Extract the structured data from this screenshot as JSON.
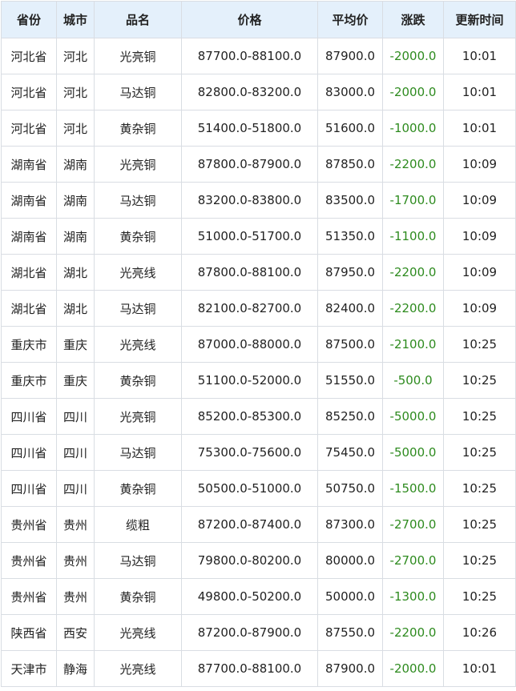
{
  "table": {
    "headers": [
      "省份",
      "城市",
      "品名",
      "价格",
      "平均价",
      "涨跌",
      "更新时间"
    ],
    "rows": [
      [
        "河北省",
        "河北",
        "光亮铜",
        "87700.0-88100.0",
        "87900.0",
        "-2000.0",
        "10:01"
      ],
      [
        "河北省",
        "河北",
        "马达铜",
        "82800.0-83200.0",
        "83000.0",
        "-2000.0",
        "10:01"
      ],
      [
        "河北省",
        "河北",
        "黄杂铜",
        "51400.0-51800.0",
        "51600.0",
        "-1000.0",
        "10:01"
      ],
      [
        "湖南省",
        "湖南",
        "光亮铜",
        "87800.0-87900.0",
        "87850.0",
        "-2200.0",
        "10:09"
      ],
      [
        "湖南省",
        "湖南",
        "马达铜",
        "83200.0-83800.0",
        "83500.0",
        "-1700.0",
        "10:09"
      ],
      [
        "湖南省",
        "湖南",
        "黄杂铜",
        "51000.0-51700.0",
        "51350.0",
        "-1100.0",
        "10:09"
      ],
      [
        "湖北省",
        "湖北",
        "光亮线",
        "87800.0-88100.0",
        "87950.0",
        "-2200.0",
        "10:09"
      ],
      [
        "湖北省",
        "湖北",
        "马达铜",
        "82100.0-82700.0",
        "82400.0",
        "-2200.0",
        "10:09"
      ],
      [
        "重庆市",
        "重庆",
        "光亮线",
        "87000.0-88000.0",
        "87500.0",
        "-2100.0",
        "10:25"
      ],
      [
        "重庆市",
        "重庆",
        "黄杂铜",
        "51100.0-52000.0",
        "51550.0",
        "-500.0",
        "10:25"
      ],
      [
        "四川省",
        "四川",
        "光亮铜",
        "85200.0-85300.0",
        "85250.0",
        "-5000.0",
        "10:25"
      ],
      [
        "四川省",
        "四川",
        "马达铜",
        "75300.0-75600.0",
        "75450.0",
        "-5000.0",
        "10:25"
      ],
      [
        "四川省",
        "四川",
        "黄杂铜",
        "50500.0-51000.0",
        "50750.0",
        "-1500.0",
        "10:25"
      ],
      [
        "贵州省",
        "贵州",
        "缆粗",
        "87200.0-87400.0",
        "87300.0",
        "-2700.0",
        "10:25"
      ],
      [
        "贵州省",
        "贵州",
        "马达铜",
        "79800.0-80200.0",
        "80000.0",
        "-2700.0",
        "10:25"
      ],
      [
        "贵州省",
        "贵州",
        "黄杂铜",
        "49800.0-50200.0",
        "50000.0",
        "-1300.0",
        "10:25"
      ],
      [
        "陕西省",
        "西安",
        "光亮线",
        "87200.0-87900.0",
        "87550.0",
        "-2200.0",
        "10:26"
      ],
      [
        "天津市",
        "静海",
        "光亮线",
        "87700.0-88100.0",
        "87900.0",
        "-2000.0",
        "10:01"
      ]
    ]
  },
  "colors": {
    "header_background": "#e4f0fb",
    "border": "#d9dde3",
    "text": "#222222",
    "change_down": "#2e8b1f"
  }
}
